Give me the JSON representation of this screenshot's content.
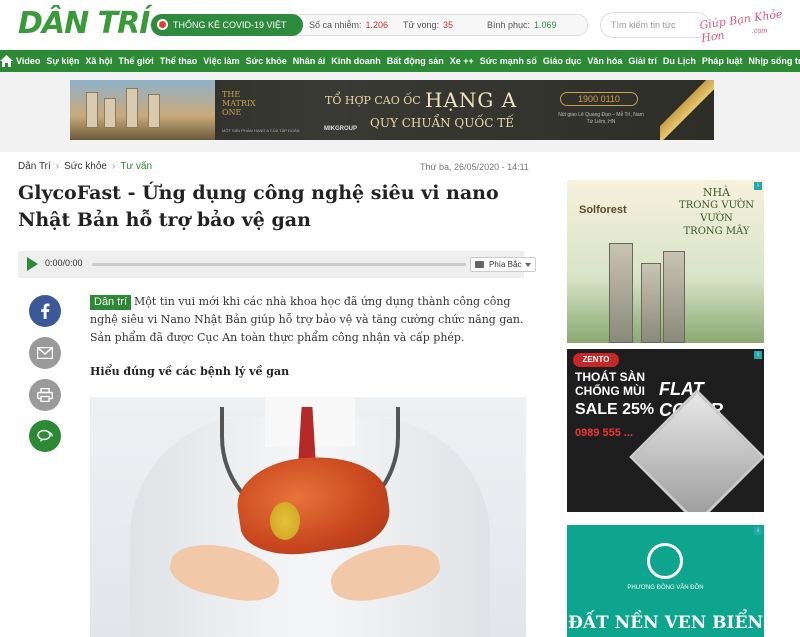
{
  "header": {
    "logo": "DÂN TRÍ",
    "covid": {
      "label": "THỐNG KÊ COVID-19 VIỆT NAM",
      "cases_label": "Số ca nhiễm:",
      "cases_value": "1.206",
      "deaths_label": "Tử vong:",
      "deaths_value": "35",
      "recovered_label": "Bình phục:",
      "recovered_value": "1.069"
    },
    "search_placeholder": "Tìm kiếm tin tức",
    "watermark": "Giúp Bạn Khỏe Hơn",
    "watermark_sub": ".com"
  },
  "nav": {
    "items": [
      "Video",
      "Sự kiện",
      "Xã hội",
      "Thế giới",
      "Thể thao",
      "Việc làm",
      "Sức khỏe",
      "Nhân ái",
      "Kinh doanh",
      "Bất động sản",
      "Xe ++",
      "Sức mạnh số",
      "Giáo dục",
      "Văn hóa",
      "Giải trí",
      "Du Lịch",
      "Pháp luật",
      "Nhịp sống trẻ"
    ]
  },
  "banner": {
    "brand_line1": "THE",
    "brand_line2": "MATRIX",
    "brand_line3": "ONE",
    "brand_sub": "MỘT SẢN PHẨM HẠNG A CỦA TẬP ĐOÀN",
    "group": "MIKGROUP",
    "headline_a": "TỔ HỢP CAO ỐC",
    "headline_b": "HẠNG A",
    "headline_c": "QUY CHUẨN QUỐC TẾ",
    "phone": "1900 0110",
    "address": "Nút giao Lê Quang Đạo – Mễ Trì, Nam Từ Liêm, HN"
  },
  "breadcrumb": {
    "root": "Dân Trí",
    "section": "Sức khỏe",
    "current": "Tư vấn",
    "separator": "›"
  },
  "article": {
    "date": "Thứ ba, 26/05/2020 - 14:11",
    "title": "GlycoFast - Ứng dụng công nghệ siêu vi nano Nhật Bản hỗ trợ bảo vệ gan",
    "audio_time": "0:00/0:00",
    "audio_region": "Phía Bắc",
    "lead_tag": "Dân trí",
    "lead_text": "Một tin vui mới khi các nhà khoa học đã ứng dụng thành công công nghệ siêu vi Nano Nhật Bản giúp hỗ trợ bảo vệ và tăng cường chức năng gan. Sản phẩm đã được Cục An toàn thực phẩm công nhận và cấp phép.",
    "subhead": "Hiểu đúng về các bệnh lý về gan"
  },
  "ads": {
    "ad1_brand": "Solforest",
    "ad1_line1": "NHÀ",
    "ad1_line2": "TRONG VƯỜN",
    "ad1_line3": "VƯỜN",
    "ad1_line4": "TRONG MÂY",
    "ad2_brand": "ZENTO",
    "ad2_line1": "THOÁT SÀN",
    "ad2_line2": "CHỐNG MÙI",
    "ad2_flat": "FLAT COVER",
    "ad2_sale": "SALE 25%",
    "ad2_phone": "0989 555 ...",
    "ad3_company": "PHƯƠNG ĐÔNG VÂN ĐỒN",
    "ad3_headline": "ĐẤT NỀN VEN BIỂN"
  },
  "colors": {
    "brand_green": "#2d8a34",
    "covid_red": "#d32f2f",
    "facebook": "#3b5998"
  }
}
